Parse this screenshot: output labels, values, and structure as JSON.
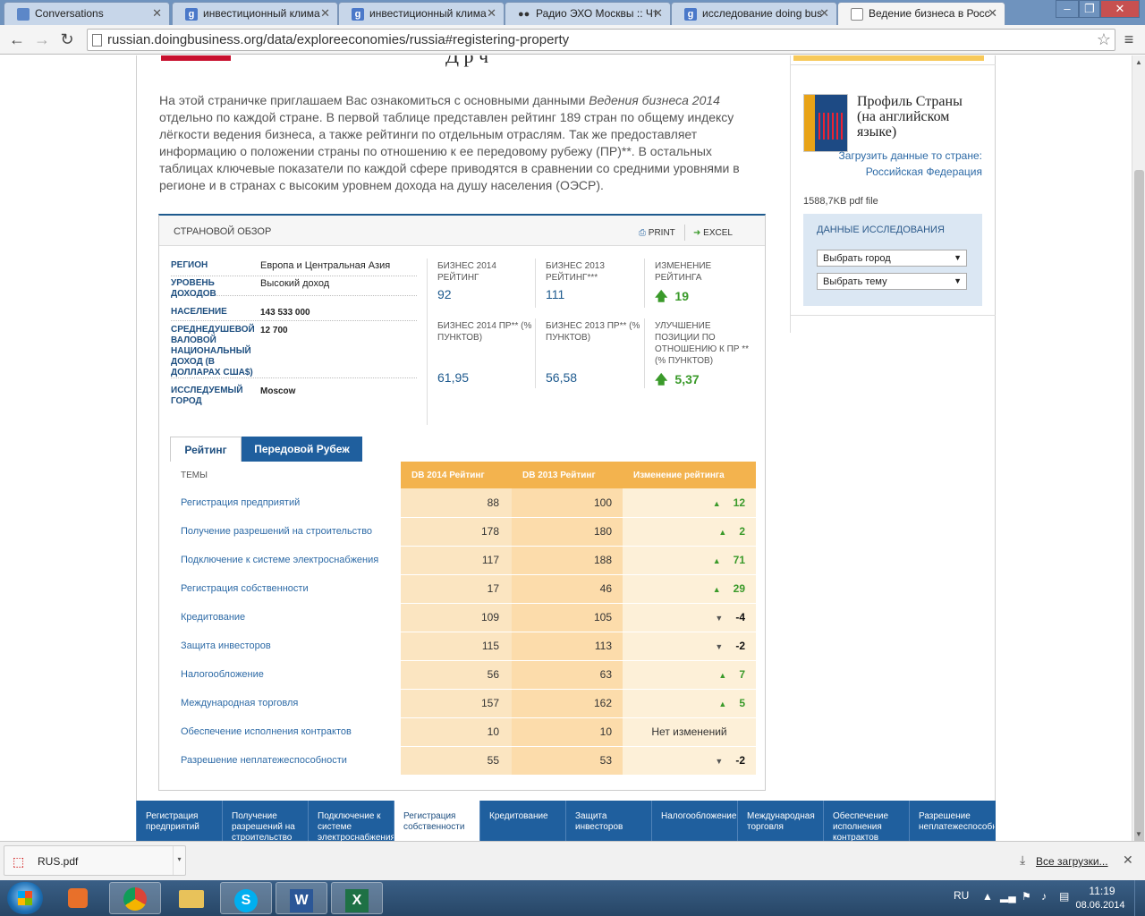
{
  "browser": {
    "tabs": [
      {
        "title": "Conversations",
        "icon": "chat-icon"
      },
      {
        "title": "инвестиционный клима",
        "icon": "google-icon"
      },
      {
        "title": "инвестиционный клима",
        "icon": "google-icon"
      },
      {
        "title": "Радио ЭХО Москвы :: Чт",
        "icon": "echo-icon"
      },
      {
        "title": "исследование doing bus",
        "icon": "google-icon"
      },
      {
        "title": "Ведение бизнеса в Росс",
        "icon": "page-icon"
      }
    ],
    "url": "russian.doingbusiness.org/data/exploreeconomies/russia#registering-property"
  },
  "intro": {
    "text_before": "На этой страничке приглашаем Вас ознакомиться с основными данными ",
    "text_italic": "Ведения бизнеса 2014",
    "text_after": " отдельно по каждой стране. В первой таблице представлен рейтинг 189 стран по общему индексу лёгкости ведения бизнеса, а также рейтинги по отдельным отраслям. Так же предоставляет информацию о положении страны по отношению к ее передовому рубежу (ПР)**. В остальных таблицах ключевые показатели по каждой сфере приводятся в сравнении со средними уровнями в регионе и в странах с высоким уровнем дохода на душу населения (ОЭСР)."
  },
  "overview": {
    "title": "СТРАНОВОЙ ОБЗОР",
    "print_label": "PRINT",
    "excel_label": "EXCEL",
    "info": [
      {
        "label": "РЕГИОН",
        "value": "Европа и Центральная Азия"
      },
      {
        "label": "УРОВЕНЬ ДОХОДОВ",
        "value": "Высокий доход"
      },
      {
        "label": "НАСЕЛЕНИЕ",
        "value": "143 533 000"
      },
      {
        "label": "СРЕДНЕДУШЕВОЙ ВАЛОВОЙ НАЦИОНАЛЬНЫЙ ДОХОД (В ДОЛЛАРАХ США$)",
        "value": "12 700"
      },
      {
        "label": "ИССЛЕДУЕМЫЙ ГОРОД",
        "value": "Moscow"
      }
    ],
    "stats": [
      {
        "label": "БИЗНЕС 2014 РЕЙТИНГ",
        "value": "92"
      },
      {
        "label": "БИЗНЕС 2013 РЕЙТИНГ***",
        "value": "111"
      },
      {
        "label": "ИЗМЕНЕНИЕ РЕЙТИНГА",
        "value": "19"
      },
      {
        "label": "БИЗНЕС 2014 ПР** (% ПУНКТОВ)",
        "value": "61,95"
      },
      {
        "label": "БИЗНЕС 2013 ПР** (% ПУНКТОВ)",
        "value": "56,58"
      },
      {
        "label": "УЛУЧШЕНИЕ ПОЗИЦИИ ПО ОТНОШЕНИЮ К ПР ** (% ПУНКТОВ)",
        "value": "5,37"
      }
    ],
    "tabs": [
      "Рейтинг",
      "Передовой Рубеж"
    ],
    "table": {
      "headers": [
        "ТЕМЫ",
        "DB 2014 Рейтинг",
        "DB 2013 Рейтинг",
        "Изменение рейтинга"
      ],
      "rows": [
        {
          "topic": "Регистрация предприятий",
          "db2014": "88",
          "db2013": "100",
          "change": "12",
          "dir": "up"
        },
        {
          "topic": "Получение разрешений на строительство",
          "db2014": "178",
          "db2013": "180",
          "change": "2",
          "dir": "up"
        },
        {
          "topic": "Подключение к системе электроснабжения",
          "db2014": "117",
          "db2013": "188",
          "change": "71",
          "dir": "up"
        },
        {
          "topic": "Регистрация собственности",
          "db2014": "17",
          "db2013": "46",
          "change": "29",
          "dir": "up"
        },
        {
          "topic": "Кредитование",
          "db2014": "109",
          "db2013": "105",
          "change": "-4",
          "dir": "down"
        },
        {
          "topic": "Защита инвесторов",
          "db2014": "115",
          "db2013": "113",
          "change": "-2",
          "dir": "down"
        },
        {
          "topic": "Налогообложение",
          "db2014": "56",
          "db2013": "63",
          "change": "7",
          "dir": "up"
        },
        {
          "topic": "Международная торговля",
          "db2014": "157",
          "db2013": "162",
          "change": "5",
          "dir": "up"
        },
        {
          "topic": "Обеспечение исполнения контрактов",
          "db2014": "10",
          "db2013": "10",
          "change": "Нет изменений",
          "dir": "none"
        },
        {
          "topic": "Разрешение неплатежеспособности",
          "db2014": "55",
          "db2013": "53",
          "change": "-2",
          "dir": "down"
        }
      ]
    }
  },
  "sidebar": {
    "profile_title": "Профиль Страны (на английском языке)",
    "profile_link": "Загрузить данные то стране: Российская Федерация",
    "file_size": "1588,7KB pdf file",
    "research_title": "ДАННЫЕ ИССЛЕДОВАНИЯ",
    "select_city": "Выбрать город",
    "select_topic": "Выбрать тему"
  },
  "bottom_nav": [
    "Регистрация предприятий",
    "Получение разрешений на строительство",
    "Подключение к системе электроснабжения",
    "Регистрация собственности",
    "Кредитование",
    "Защита инвесторов",
    "Налогообложение",
    "Международная торговля",
    "Обеспечение исполнения контрактов",
    "Разрешение неплатежеспособности"
  ],
  "bottom_nav_active": "Регистрация собственности",
  "downloads": {
    "file_name": "RUS.pdf",
    "all_label": "Все загрузки..."
  },
  "taskbar": {
    "language": "RU",
    "time": "11:19",
    "date": "08.06.2014"
  },
  "colors": {
    "accent_blue": "#1f5f9e",
    "table_header_orange": "#f3b34e",
    "positive_green": "#3a9a2a"
  }
}
